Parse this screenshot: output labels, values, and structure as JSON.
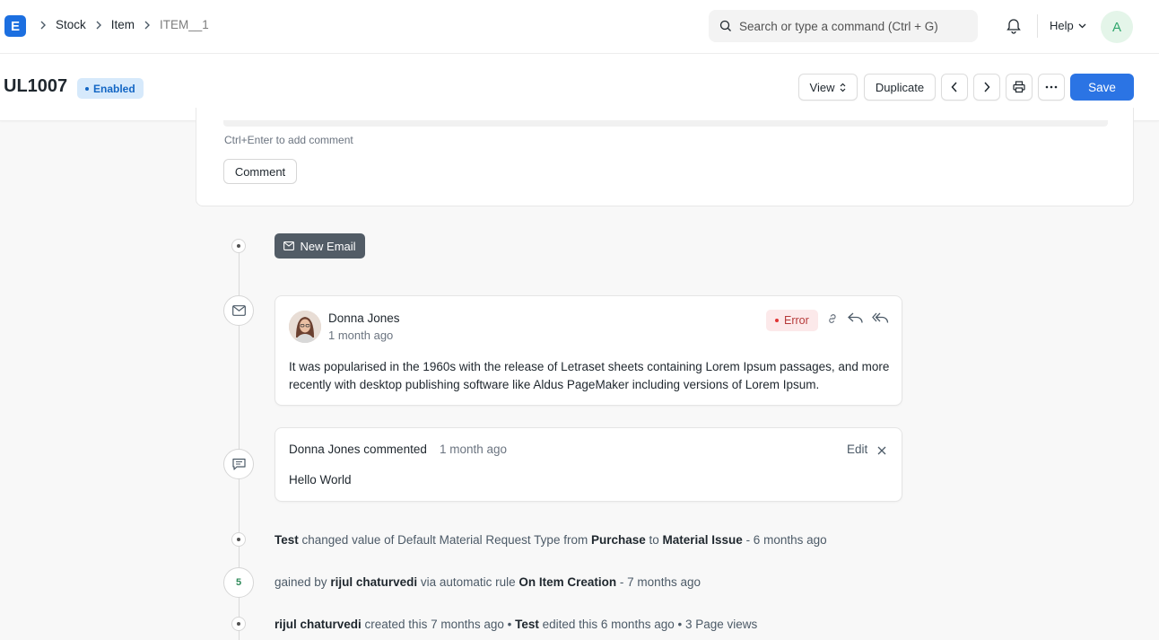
{
  "navbar": {
    "logo_letter": "E",
    "breadcrumbs": [
      "Stock",
      "Item",
      "ITEM__1"
    ],
    "search_placeholder": "Search or type a command (Ctrl + G)",
    "help_label": "Help",
    "avatar_letter": "A"
  },
  "header": {
    "title": "UL1007",
    "status": "Enabled",
    "view_label": "View",
    "duplicate_label": "Duplicate",
    "save_label": "Save"
  },
  "comment_box": {
    "hint": "Ctrl+Enter to add comment",
    "button_label": "Comment"
  },
  "timeline": {
    "new_email_label": "New Email",
    "email": {
      "sender": "Donna Jones",
      "time": "1 month ago",
      "status": "Error",
      "body": "It was popularised in the 1960s with the release of Letraset sheets containing Lorem Ipsum passages, and more recently with desktop publishing software like Aldus PageMaker including versions of Lorem Ipsum."
    },
    "comment": {
      "author": "Donna Jones commented",
      "time": "1 month ago",
      "edit_label": "Edit",
      "text": "Hello World"
    },
    "activity_1": {
      "user": "Test",
      "text1": " changed value of Default Material Request Type from ",
      "from": "Purchase",
      "text2": " to ",
      "to": "Material Issue",
      "time": " - 6 months ago"
    },
    "activity_2": {
      "badge": "5",
      "text1": "gained by ",
      "user": "rijul chaturvedi",
      "text2": " via automatic rule ",
      "rule": "On Item Creation",
      "time": " - 7 months ago"
    },
    "activity_3": {
      "creator": "rijul chaturvedi",
      "text1": " created this 7 months ago • ",
      "editor": "Test",
      "text2": " edited this 6 months ago • 3 Page views"
    }
  },
  "colors": {
    "primary": "#2b74e4",
    "error": "#e03636",
    "enabled": "#1366c4"
  }
}
